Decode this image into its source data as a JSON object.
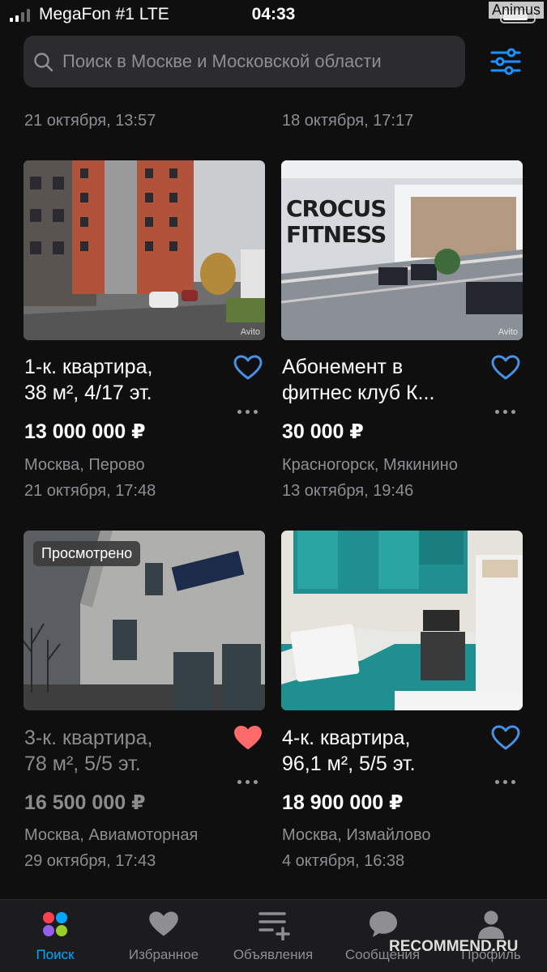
{
  "status_bar": {
    "carrier": "MegaFon #1  LTE",
    "time": "04:33",
    "watermark": "Animus"
  },
  "search": {
    "placeholder": "Поиск в Москве и Московской области",
    "icon": "search-icon",
    "filter_icon": "filter-sliders-icon"
  },
  "top_dates": [
    "21 октября, 13:57",
    "18 октября, 17:17"
  ],
  "listings": [
    {
      "title_line1": "1-к. квартира,",
      "title_line2": "38 м², 4/17 эт.",
      "price": "13 000 000 ₽",
      "location": "Москва, Перово",
      "date": "21 октября, 17:48",
      "favorited": false,
      "photo_watermark": "Avito"
    },
    {
      "title_line1": "Абонемент в",
      "title_line2": "фитнес клуб К...",
      "price": "30 000 ₽",
      "location": "Красногорск, Мякинино",
      "date": "13 октября, 19:46",
      "favorited": false,
      "photo_watermark": "Avito",
      "photo_text_line1": "CROCUS",
      "photo_text_line2": "FITNESS"
    },
    {
      "title_line1": "3-к. квартира,",
      "title_line2": "78 м², 5/5 эт.",
      "price": "16 500 000 ₽",
      "location": "Москва, Авиамоторная",
      "date": "29 октября, 17:43",
      "favorited": true,
      "viewed_badge": "Просмотрено"
    },
    {
      "title_line1": "4-к. квартира,",
      "title_line2": "96,1 м², 5/5 эт.",
      "price": "18 900 000 ₽",
      "location": "Москва, Измайлово",
      "date": "4 октября, 16:38",
      "favorited": false
    }
  ],
  "tab_bar": {
    "tabs": [
      {
        "label": "Поиск",
        "icon": "search-dots-icon",
        "active": true
      },
      {
        "label": "Избранное",
        "icon": "heart-icon",
        "active": false
      },
      {
        "label": "Объявления",
        "icon": "add-listing-icon",
        "active": false
      },
      {
        "label": "Сообщения",
        "icon": "chat-bubble-icon",
        "active": false
      },
      {
        "label": "Профиль",
        "icon": "profile-icon",
        "active": false
      }
    ],
    "watermark": "RECOMMEND.RU"
  },
  "colors": {
    "background": "#0f0f0f",
    "accent": "#00aaff",
    "heart_outline": "#4a90e2",
    "heart_filled": "#ff6b6b",
    "muted_text": "#8e8e93"
  }
}
